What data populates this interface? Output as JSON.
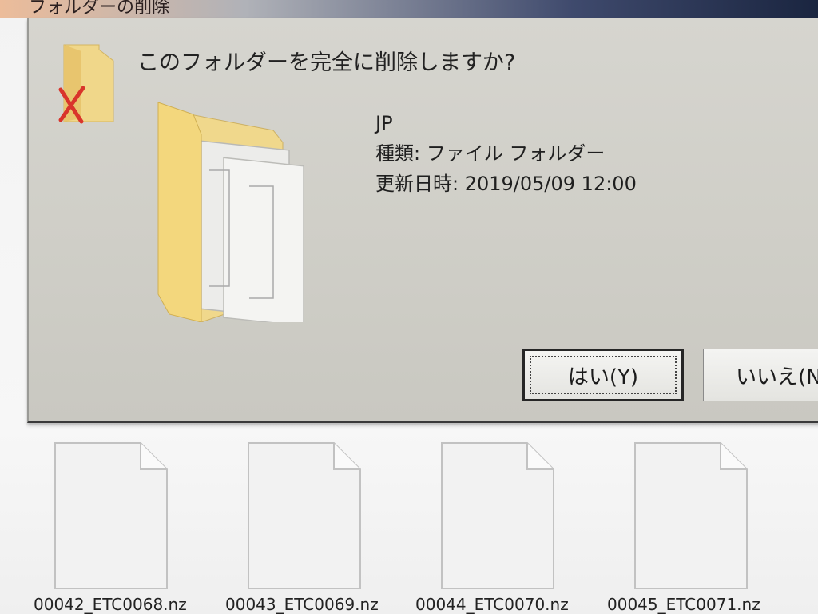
{
  "window": {
    "title": "フォルダーの削除"
  },
  "dialog": {
    "question": "このフォルダーを完全に削除しますか?",
    "item_name": "JP",
    "type_label": "種類: ファイル フォルダー",
    "modified_label": "更新日時: 2019/05/09 12:00",
    "yes_button": "はい(Y)",
    "no_button": "いいえ(N)"
  },
  "files": [
    {
      "name": "00042_ETC0068.nz"
    },
    {
      "name": "00043_ETC0069.nz"
    },
    {
      "name": "00044_ETC0070.nz"
    },
    {
      "name": "00045_ETC0071.nz"
    }
  ],
  "colors": {
    "folder_yellow": "#f1d98c",
    "delete_x": "#d9342b",
    "dialog_bg": "#d2d1ca"
  }
}
